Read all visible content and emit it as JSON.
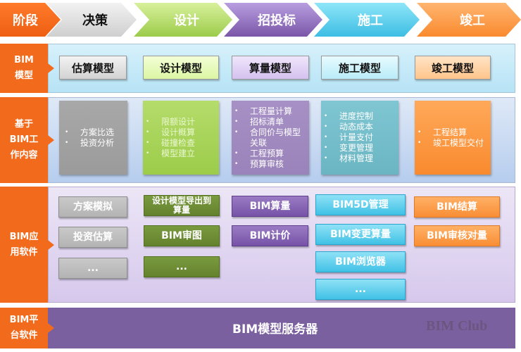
{
  "phases": {
    "header": "阶段",
    "items": [
      "决策",
      "设计",
      "招投标",
      "施工",
      "竣工"
    ]
  },
  "rows": {
    "models_label": [
      "BIM",
      "模型"
    ],
    "work_label": [
      "基于",
      "BIM工",
      "作内容"
    ],
    "software_label": [
      "BIM应",
      "用软件"
    ],
    "platform_label": [
      "BIM平",
      "台软件"
    ]
  },
  "models": [
    "估算模型",
    "设计模型",
    "算量模型",
    "施工模型",
    "竣工模型"
  ],
  "work": [
    [
      "方案比选",
      "投资分析"
    ],
    [
      "限额设计",
      "设计概算",
      "碰撞检查",
      "模型建立"
    ],
    [
      "工程量计算",
      "招标清单",
      "合同价与模型关联",
      "工程预算",
      "预算审核"
    ],
    [
      "进度控制",
      "动态成本",
      "计量支付",
      "变更管理",
      "材料管理"
    ],
    [
      "工程结算",
      "竣工模型交付"
    ]
  ],
  "software": {
    "decision": [
      "方案模拟",
      "投资估算",
      "..."
    ],
    "design": [
      "设计模型导出到算量",
      "BIM审图",
      "..."
    ],
    "bidding": [
      "BIM算量",
      "BIM计价"
    ],
    "construction": [
      "BIM5D管理",
      "BIM变更算量",
      "BIM浏览器",
      "..."
    ],
    "completion": [
      "BIM结算",
      "BIM审核对量"
    ]
  },
  "platform": {
    "server": "BIM模型服务器",
    "watermark": "BIM Club"
  },
  "colors": {
    "accent_orange": "#f26b1d",
    "decision_gray": "#b3b3b3",
    "design_green": "#9ccc4a",
    "bidding_purple": "#8a6bb8",
    "construction_cyan": "#41c1e6",
    "completion_orange": "#f98e35",
    "platform_purple": "#7b609f"
  }
}
